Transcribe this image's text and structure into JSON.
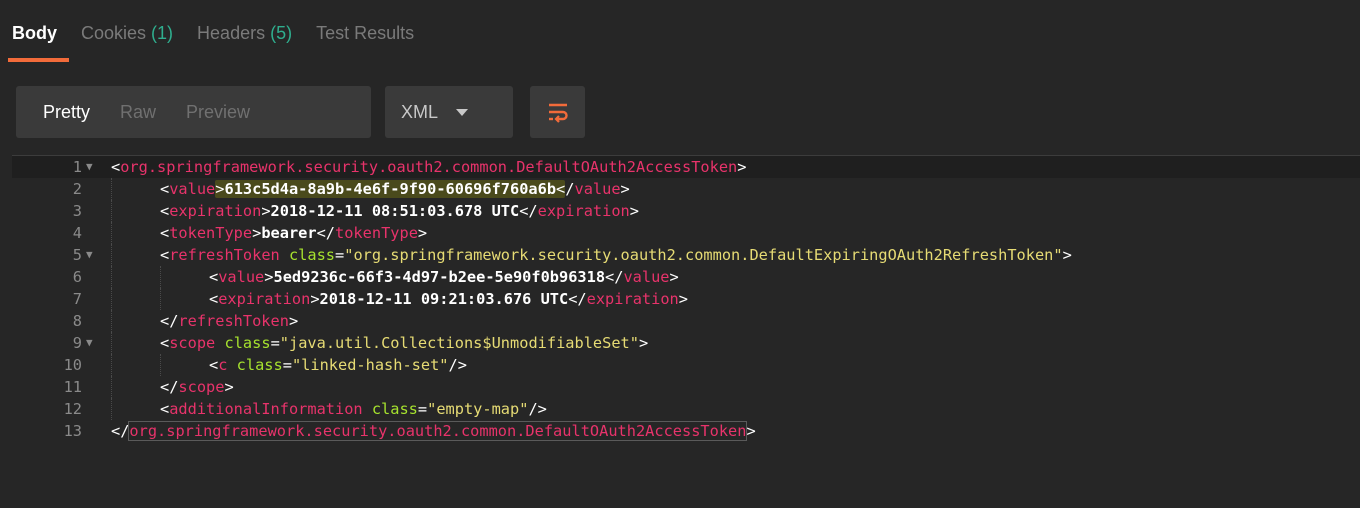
{
  "tabs": [
    {
      "label": "Body",
      "count": null,
      "active": true
    },
    {
      "label": "Cookies",
      "count": "(1)",
      "active": false
    },
    {
      "label": "Headers",
      "count": "(5)",
      "active": false
    },
    {
      "label": "Test Results",
      "count": null,
      "active": false
    }
  ],
  "view_modes": [
    "Pretty",
    "Raw",
    "Preview"
  ],
  "language": {
    "selected": "XML"
  },
  "wrap_button": {
    "icon": "wrap-lines-icon",
    "color": "#f26b3a"
  },
  "colors": {
    "accent": "#f26b3a",
    "tag": "#e8336b",
    "attr": "#a6e22e",
    "string": "#e6db74",
    "count": "#2fae8e"
  },
  "code": {
    "lines": [
      {
        "num": "1",
        "fold": true
      },
      {
        "num": "2",
        "fold": false
      },
      {
        "num": "3",
        "fold": false
      },
      {
        "num": "4",
        "fold": false
      },
      {
        "num": "5",
        "fold": true
      },
      {
        "num": "6",
        "fold": false
      },
      {
        "num": "7",
        "fold": false
      },
      {
        "num": "8",
        "fold": false
      },
      {
        "num": "9",
        "fold": true
      },
      {
        "num": "10",
        "fold": false
      },
      {
        "num": "11",
        "fold": false
      },
      {
        "num": "12",
        "fold": false
      },
      {
        "num": "13",
        "fold": false
      }
    ],
    "root_tag": "org.springframework.security.oauth2.common.DefaultOAuth2AccessToken",
    "value_tag": "value",
    "access_token_value": "613c5d4a-8a9b-4e6f-9f90-60696f760a6b",
    "expiration_tag": "expiration",
    "access_expiration": "2018-12-11 08:51:03.678 UTC",
    "token_type_tag": "tokenType",
    "token_type": "bearer",
    "refresh_tag": "refreshToken",
    "class_attr": "class",
    "refresh_class": "\"org.springframework.security.oauth2.common.DefaultExpiringOAuth2RefreshToken\"",
    "refresh_value": "5ed9236c-66f3-4d97-b2ee-5e90f0b96318",
    "refresh_expiration": "2018-12-11 09:21:03.676 UTC",
    "scope_tag": "scope",
    "scope_class": "\"java.util.Collections$UnmodifiableSet\"",
    "c_tag": "c",
    "c_class": "\"linked-hash-set\"",
    "additional_tag": "additionalInformation",
    "additional_class": "\"empty-map\""
  }
}
